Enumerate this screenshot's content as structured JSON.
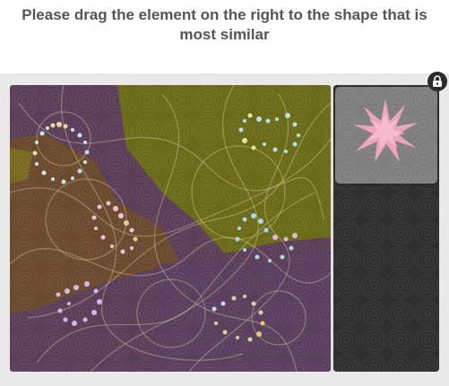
{
  "instruction": {
    "line1": "Please drag the element on the right to the shape that is",
    "line2": "most similar"
  },
  "icons": {
    "lock": "lock-icon"
  },
  "colors": {
    "background_purple": "#5c3e58",
    "olive_region": "#6a6b18",
    "brown_region": "#6b4a2e",
    "panel_dark": "#2f2f2f",
    "drag_tile": "#7f7f7f",
    "star_pink": "#f1a6c2"
  }
}
